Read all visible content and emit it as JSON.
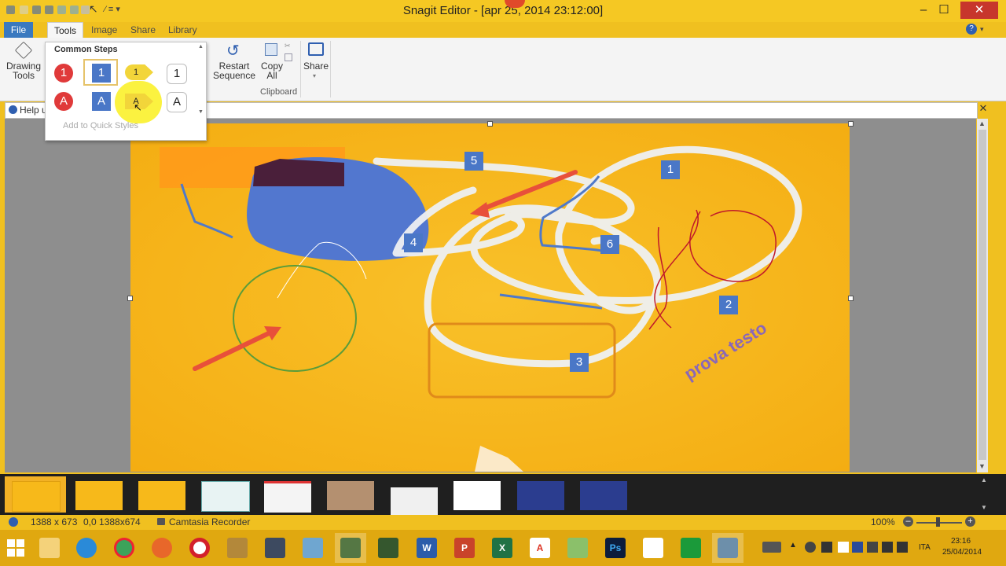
{
  "window": {
    "title": "Snagit Editor - [apr 25, 2014 23:12:00]"
  },
  "tabs": [
    {
      "label": "File"
    },
    {
      "label": "Tools"
    },
    {
      "label": "Image"
    },
    {
      "label": "Share"
    },
    {
      "label": "Library"
    }
  ],
  "ribbon": {
    "drawing_tools": "Drawing\nTools",
    "restart_sequence": "Restart\nSequence",
    "copy_all": "Copy\nAll",
    "share": "Share",
    "clipboard_group": "Clipboard"
  },
  "help": {
    "text": "Help u"
  },
  "popup": {
    "title": "Common Steps",
    "row1": [
      "1",
      "1",
      "1",
      "1"
    ],
    "row2": [
      "A",
      "A",
      "A",
      "A"
    ],
    "add_to_quick_styles": "Add to Quick Styles"
  },
  "canvas": {
    "labels": [
      "5",
      "1",
      "4",
      "6",
      "2",
      "3"
    ],
    "watermark_text": "prova testo"
  },
  "status": {
    "dimensions": "1388 x 673",
    "position": "0,0  1388x674",
    "recorder": "Camtasia Recorder",
    "zoom": "100%"
  },
  "taskbar": {
    "language": "ITA",
    "time": "23:16",
    "date": "25/04/2014"
  },
  "colors": {
    "accent_orange": "#f0c020",
    "file_tab": "#3a79bf",
    "step_blue": "#4a77c7",
    "step_red": "#e03a3a",
    "arrow_red": "#e8503a"
  }
}
